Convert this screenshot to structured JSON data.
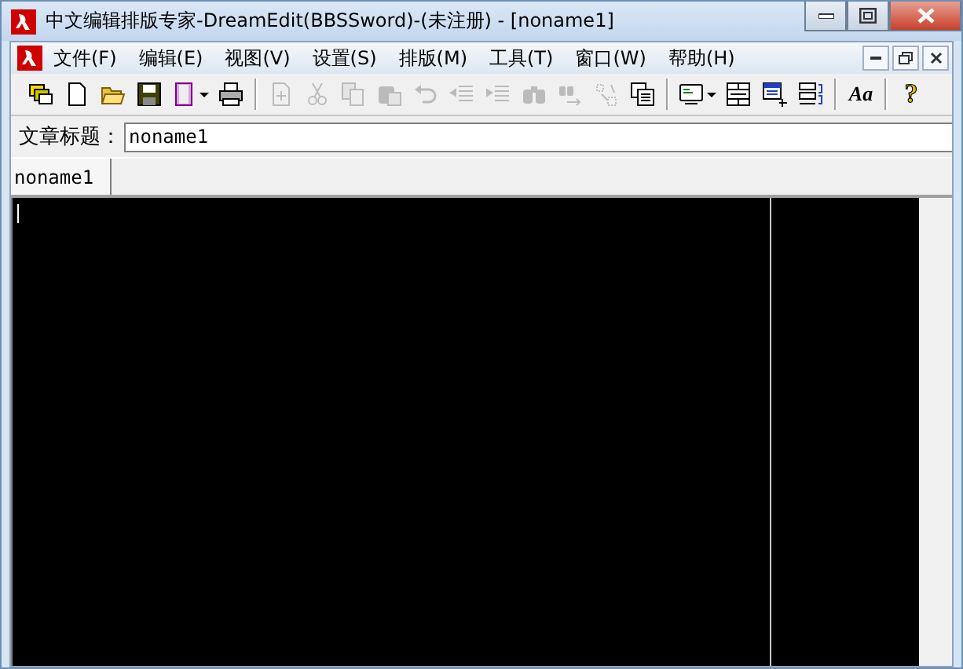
{
  "window": {
    "title": "中文编辑排版专家-DreamEdit(BBSSword)-(未注册) - [noname1]"
  },
  "menu": [
    {
      "label": "文件(F)"
    },
    {
      "label": "编辑(E)"
    },
    {
      "label": "视图(V)"
    },
    {
      "label": "设置(S)"
    },
    {
      "label": "排版(M)"
    },
    {
      "label": "工具(T)"
    },
    {
      "label": "窗口(W)"
    },
    {
      "label": "帮助(H)"
    }
  ],
  "toolbar": [
    {
      "kind": "icon",
      "disabled": false
    },
    {
      "kind": "icon",
      "disabled": false
    },
    {
      "kind": "icon",
      "disabled": false
    },
    {
      "kind": "icon",
      "disabled": false
    },
    {
      "kind": "dropdown",
      "disabled": false
    },
    {
      "kind": "icon",
      "disabled": false
    },
    {
      "kind": "icon",
      "disabled": true
    },
    {
      "kind": "icon",
      "disabled": true
    },
    {
      "kind": "icon",
      "disabled": true
    },
    {
      "kind": "icon",
      "disabled": true
    },
    {
      "kind": "icon",
      "disabled": true
    },
    {
      "kind": "icon",
      "disabled": true
    },
    {
      "kind": "icon",
      "disabled": true
    },
    {
      "kind": "icon",
      "disabled": true
    },
    {
      "kind": "icon",
      "disabled": true
    },
    {
      "kind": "icon",
      "disabled": true
    },
    {
      "kind": "icon",
      "disabled": false
    },
    {
      "kind": "dropdown",
      "disabled": false
    },
    {
      "kind": "icon",
      "disabled": false
    },
    {
      "kind": "icon",
      "disabled": false
    },
    {
      "kind": "icon",
      "disabled": false
    },
    {
      "kind": "glyph",
      "glyph": "Aa",
      "disabled": false
    },
    {
      "kind": "glyph",
      "glyph": "?",
      "disabled": false
    }
  ],
  "title_field": {
    "label": "文章标题：",
    "value": "noname1"
  },
  "tabs": [
    {
      "label": "noname1",
      "selected": true
    }
  ]
}
